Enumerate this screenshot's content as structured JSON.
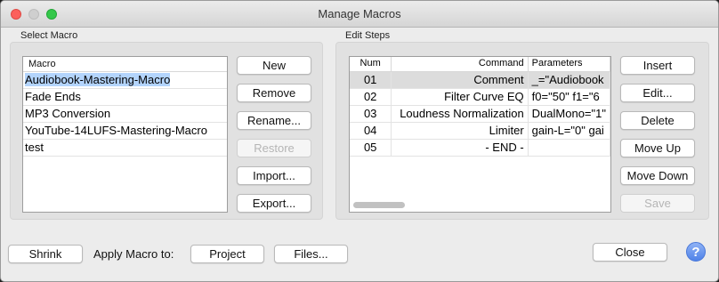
{
  "window": {
    "title": "Manage Macros"
  },
  "select_macro": {
    "label": "Select Macro",
    "column_header": "Macro",
    "items": [
      "Audiobook-Mastering-Macro",
      "Fade Ends",
      "MP3 Conversion",
      "YouTube-14LUFS-Mastering-Macro",
      "test"
    ],
    "selected_index": 0,
    "buttons": {
      "new": "New",
      "remove": "Remove",
      "rename": "Rename...",
      "restore": "Restore",
      "import": "Import...",
      "export": "Export..."
    }
  },
  "edit_steps": {
    "label": "Edit Steps",
    "columns": {
      "num": "Num",
      "command": "Command",
      "parameters": "Parameters"
    },
    "rows": [
      {
        "num": "01",
        "command": "Comment",
        "parameters": "_=\"Audiobook"
      },
      {
        "num": "02",
        "command": "Filter Curve EQ",
        "parameters": "f0=\"50\" f1=\"6"
      },
      {
        "num": "03",
        "command": "Loudness Normalization",
        "parameters": "DualMono=\"1\""
      },
      {
        "num": "04",
        "command": "Limiter",
        "parameters": "gain-L=\"0\" gai"
      },
      {
        "num": "05",
        "command": "- END -",
        "parameters": ""
      }
    ],
    "selected_index": 0,
    "buttons": {
      "insert": "Insert",
      "edit": "Edit...",
      "delete": "Delete",
      "move_up": "Move Up",
      "move_down": "Move Down",
      "save": "Save"
    }
  },
  "footer": {
    "shrink": "Shrink",
    "apply_label": "Apply Macro to:",
    "project": "Project",
    "files": "Files...",
    "close": "Close",
    "help": "?"
  }
}
